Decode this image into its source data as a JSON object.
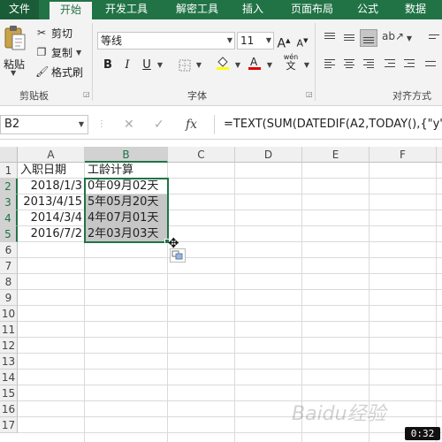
{
  "ribbon": {
    "tabs": [
      "文件",
      "开始",
      "开发工具",
      "解密工具",
      "插入",
      "页面布局",
      "公式",
      "数据"
    ],
    "active_tab": "开始",
    "clipboard": {
      "paste_label": "粘贴",
      "cut_label": "剪切",
      "copy_label": "复制",
      "format_painter_label": "格式刷",
      "group_label": "剪贴板"
    },
    "font": {
      "font_name": "等线",
      "font_size": "11",
      "bold": "B",
      "italic": "I",
      "underline": "U",
      "group_label": "字体",
      "phonetic": "wén"
    },
    "alignment": {
      "group_label": "对齐方式"
    }
  },
  "formula_bar": {
    "name_box": "B2",
    "formula": "=TEXT(SUM(DATEDIF(A2,TODAY(),{\"y\",\"",
    "fx": "fx"
  },
  "sheet": {
    "columns": [
      "A",
      "B",
      "C",
      "D",
      "E",
      "F"
    ],
    "rows": [
      "1",
      "2",
      "3",
      "4",
      "5",
      "6",
      "7",
      "8",
      "9",
      "10",
      "11",
      "12",
      "13",
      "14",
      "15",
      "16",
      "17"
    ],
    "cells": {
      "A1": "入职日期",
      "B1": "工龄计算",
      "A2": "2018/1/3",
      "B2": "0年09月02天",
      "A3": "2013/4/15",
      "B3": "5年05月20天",
      "A4": "2014/3/4",
      "B4": "4年07月01天",
      "A5": "2016/7/2",
      "B5": "2年03月03天"
    }
  },
  "watermark": "Baidu经验",
  "timer": "0:32",
  "colors": {
    "excel_green": "#217346",
    "selection_fill": "#c6c6c6"
  }
}
